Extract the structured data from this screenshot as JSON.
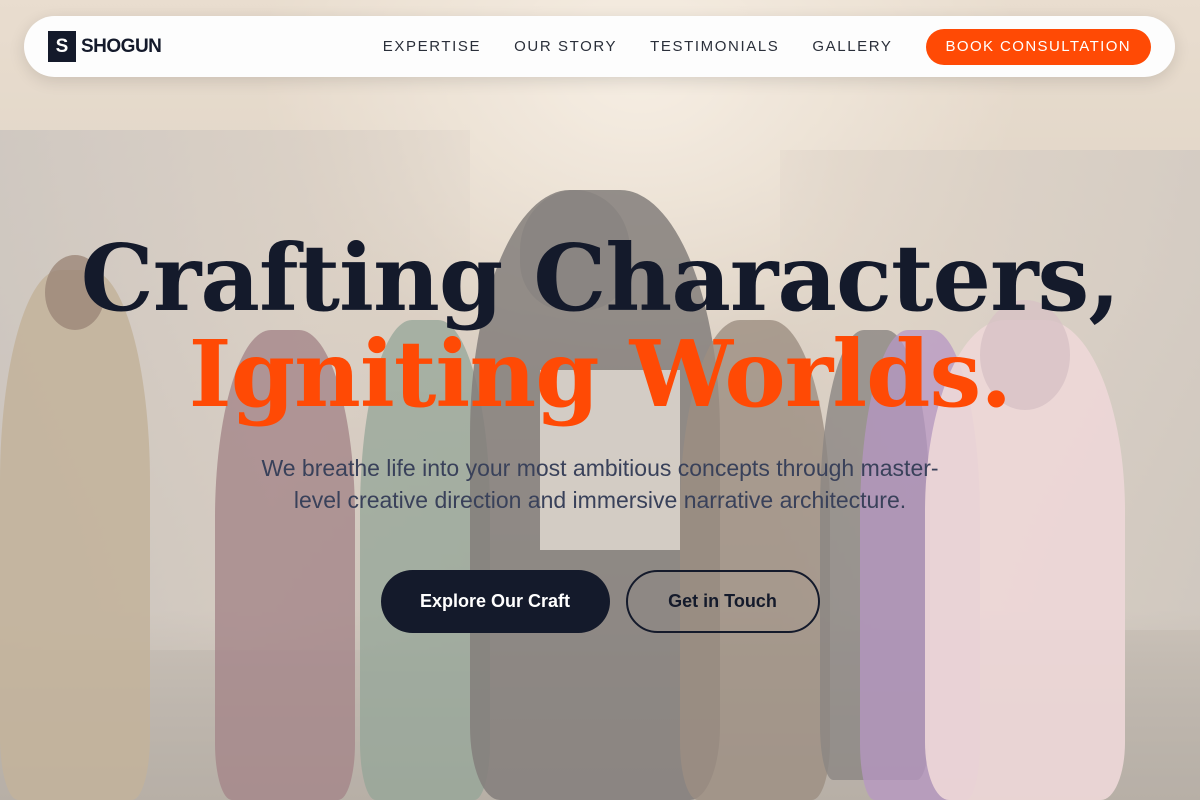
{
  "brand": {
    "logo_letter": "S",
    "name": "SHOGUN"
  },
  "nav": {
    "links": [
      "EXPERTISE",
      "OUR STORY",
      "TESTIMONIALS",
      "GALLERY"
    ],
    "cta": "BOOK CONSULTATION"
  },
  "hero": {
    "title_line1": "Crafting Characters,",
    "title_line2": "Igniting Worlds.",
    "subtitle": "We breathe life into your most ambitious concepts through master-level creative direction and immersive narrative architecture.",
    "primary_button": "Explore Our Craft",
    "secondary_button": "Get in Touch"
  },
  "colors": {
    "accent": "#ff4a05",
    "navy": "#141a2b",
    "nav_bg": "#fdfdfd"
  }
}
